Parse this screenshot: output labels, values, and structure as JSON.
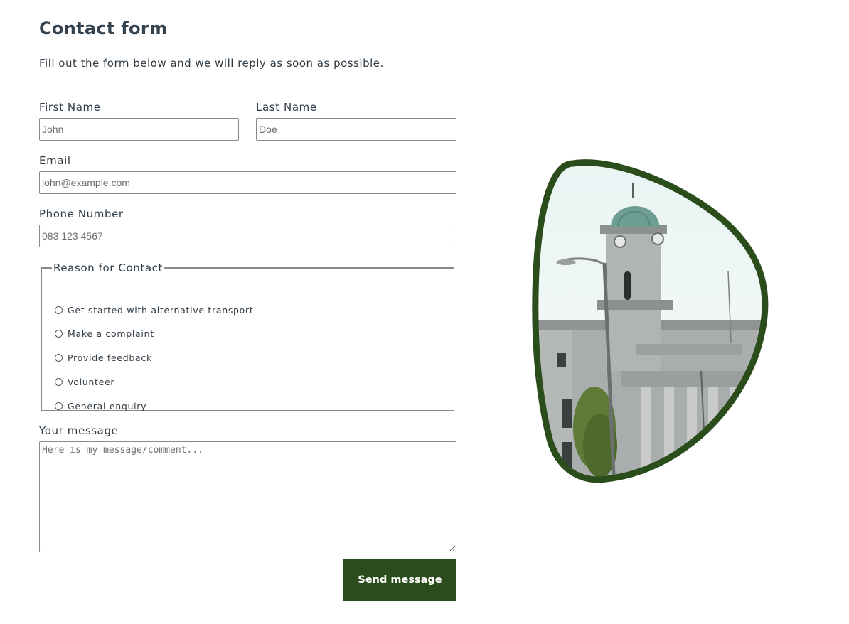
{
  "form": {
    "title": "Contact form",
    "intro": "Fill out the form below and we will reply as soon as possible.",
    "first_name": {
      "label": "First Name",
      "placeholder": "John",
      "value": ""
    },
    "last_name": {
      "label": "Last Name",
      "placeholder": "Doe",
      "value": ""
    },
    "email": {
      "label": "Email",
      "placeholder": "john@example.com",
      "value": ""
    },
    "phone": {
      "label": "Phone Number",
      "placeholder": "083 123 4567",
      "value": ""
    },
    "reason": {
      "legend": "Reason for Contact",
      "options": [
        "Get started with alternative transport",
        "Make a complaint",
        "Provide feedback",
        "Volunteer",
        "General enquiry"
      ],
      "selected": null
    },
    "message": {
      "label": "Your message",
      "placeholder": "Here is my message/comment...",
      "value": ""
    },
    "submit_label": "Send message"
  },
  "image": {
    "subject": "city-hall-clock-tower-photo",
    "frame_color": "#2b4d1c"
  },
  "colors": {
    "accent": "#2b4d1c",
    "text": "#2e3a44",
    "border": "#8a8a8a"
  }
}
